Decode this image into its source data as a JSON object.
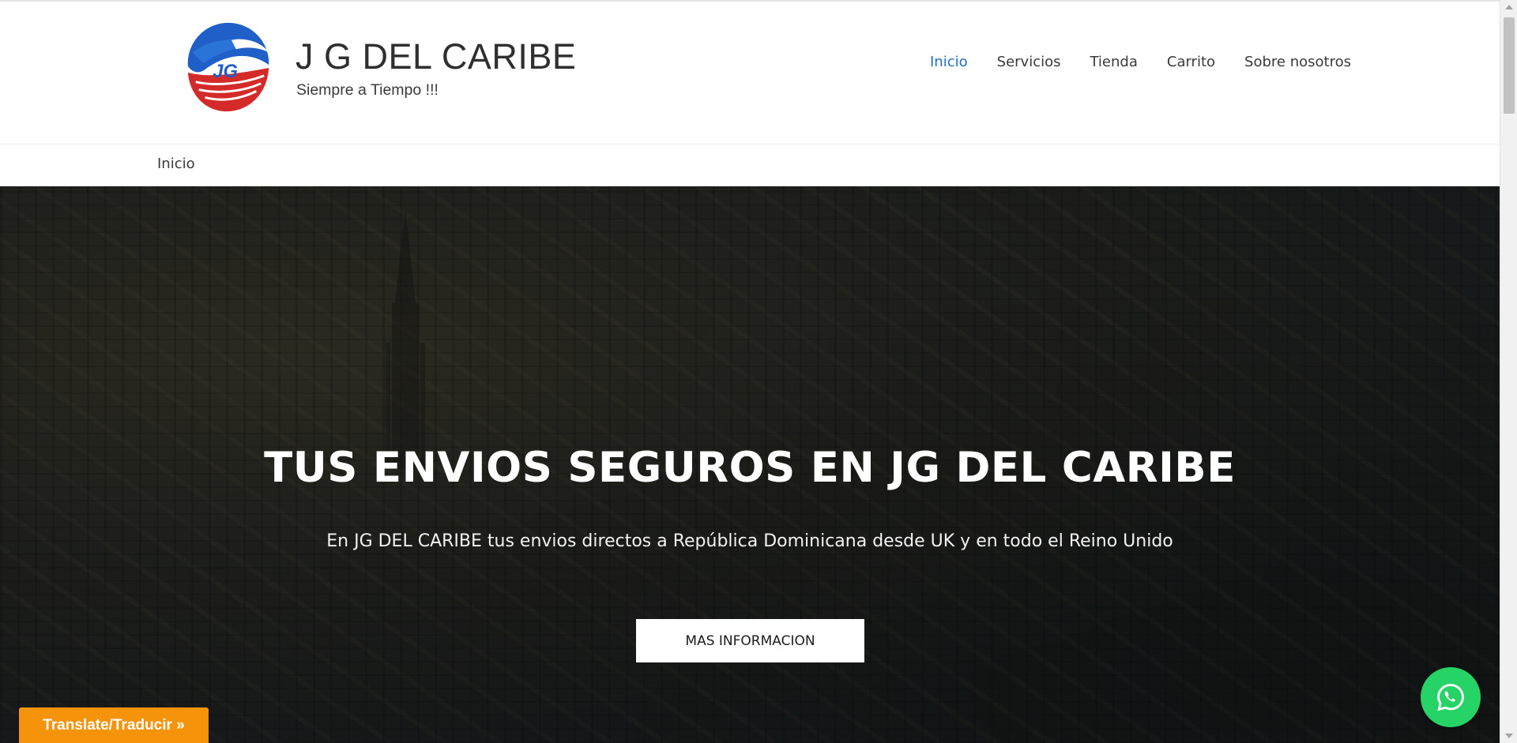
{
  "header": {
    "brand_name": "J G DEL CARIBE",
    "brand_tagline": "Siempre a Tiempo !!!",
    "logo_letters": "JG",
    "nav": [
      {
        "label": "Inicio",
        "active": true
      },
      {
        "label": "Servicios",
        "active": false
      },
      {
        "label": "Tienda",
        "active": false
      },
      {
        "label": "Carrito",
        "active": false
      },
      {
        "label": "Sobre nosotros",
        "active": false
      }
    ]
  },
  "breadcrumb": {
    "label": "Inicio"
  },
  "hero": {
    "title": "TUS ENVIOS SEGUROS EN JG DEL CARIBE",
    "subtitle": "En JG DEL CARIBE tus envios directos a República Dominicana desde UK y en todo el Reino Unido",
    "button_label": "MAS INFORMACION"
  },
  "widgets": {
    "translate_label": "Translate/Traducir »",
    "whatsapp_icon": "whatsapp-icon"
  },
  "colors": {
    "nav_active": "#1e6fc9",
    "whatsapp": "#25d366",
    "translate": "#f5930a"
  }
}
